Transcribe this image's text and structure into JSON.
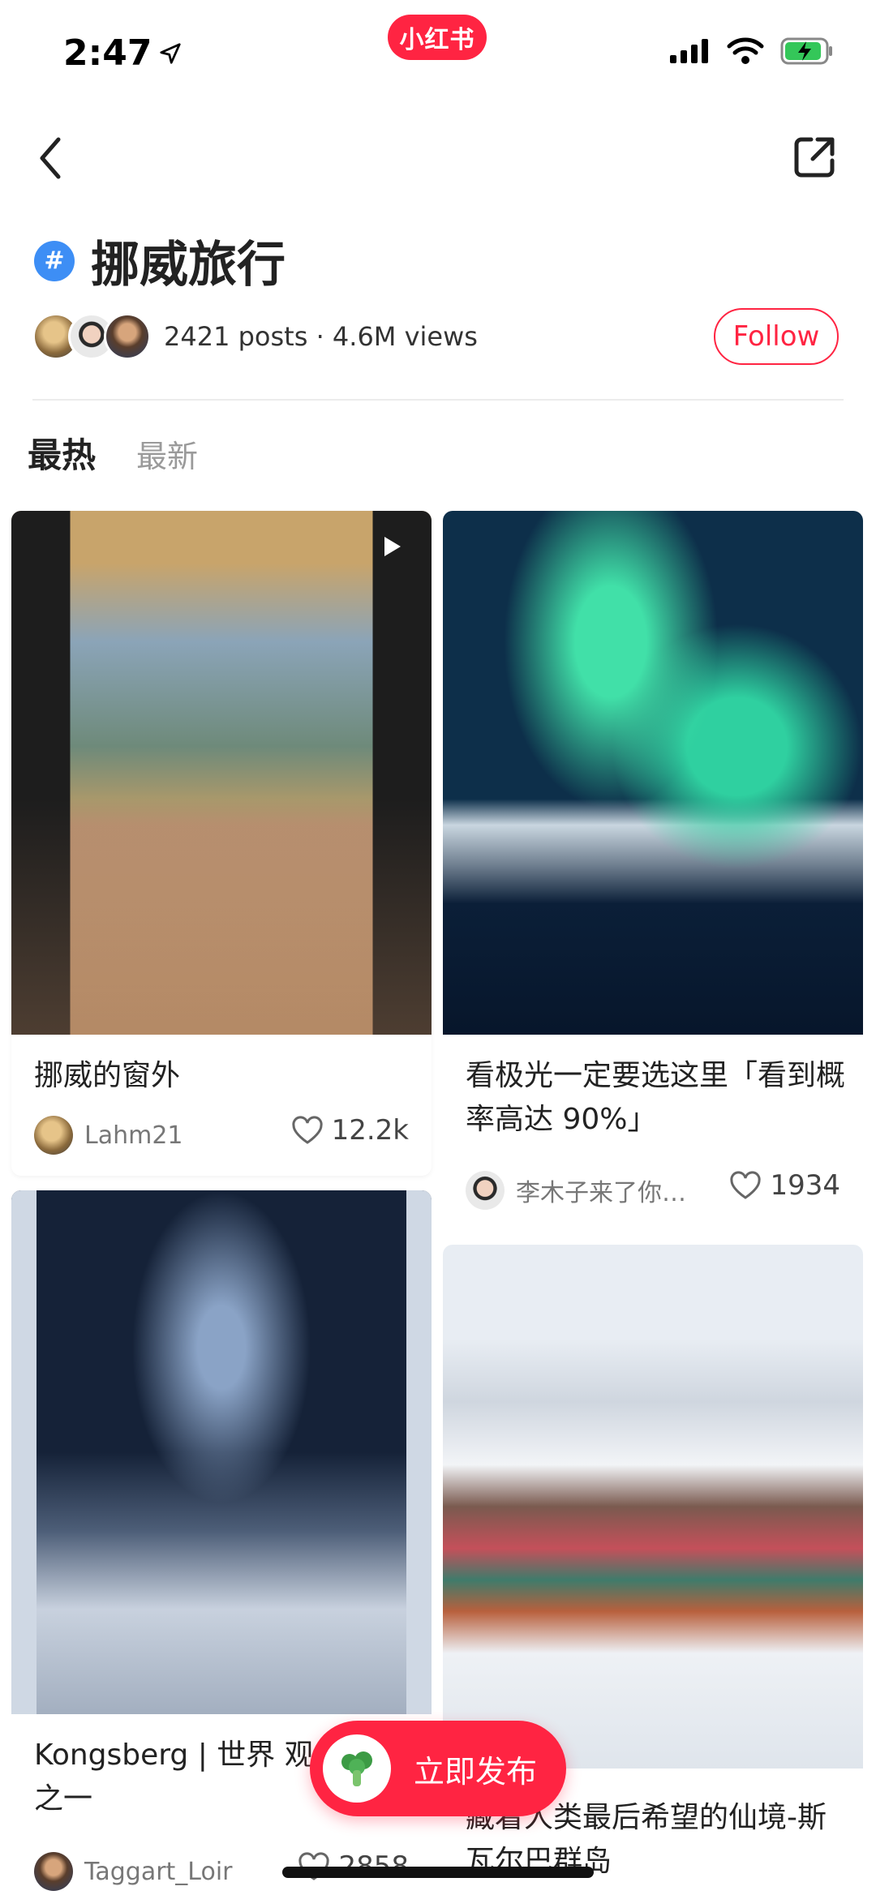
{
  "status_bar": {
    "time": "2:47",
    "brand": "小红书"
  },
  "topic": {
    "hash_symbol": "#",
    "title": "挪威旅行",
    "stats": "2421 posts · 4.6M views",
    "follow_label": "Follow"
  },
  "tabs": [
    {
      "label": "最热",
      "active": true
    },
    {
      "label": "最新",
      "active": false
    }
  ],
  "posts": [
    {
      "title": "挪威的窗外",
      "user": "Lahm21",
      "likes": "12.2k",
      "video": true
    },
    {
      "title": "看极光一定要选这里「看到概率高达 90%」",
      "user": "李木子来了你…",
      "likes": "1934",
      "video": false
    },
    {
      "title": "Kongsberg | 世界 观星圣地之一",
      "user": "Taggart_Loir",
      "likes": "2858",
      "video": false
    },
    {
      "title": "藏着人类最后希望的仙境-斯瓦尔巴群岛",
      "user": "",
      "likes": "",
      "video": false
    }
  ],
  "publish_button": {
    "label": "立即发布"
  },
  "colors": {
    "accent": "#ff2442",
    "hash_blue": "#3d8ef5"
  }
}
